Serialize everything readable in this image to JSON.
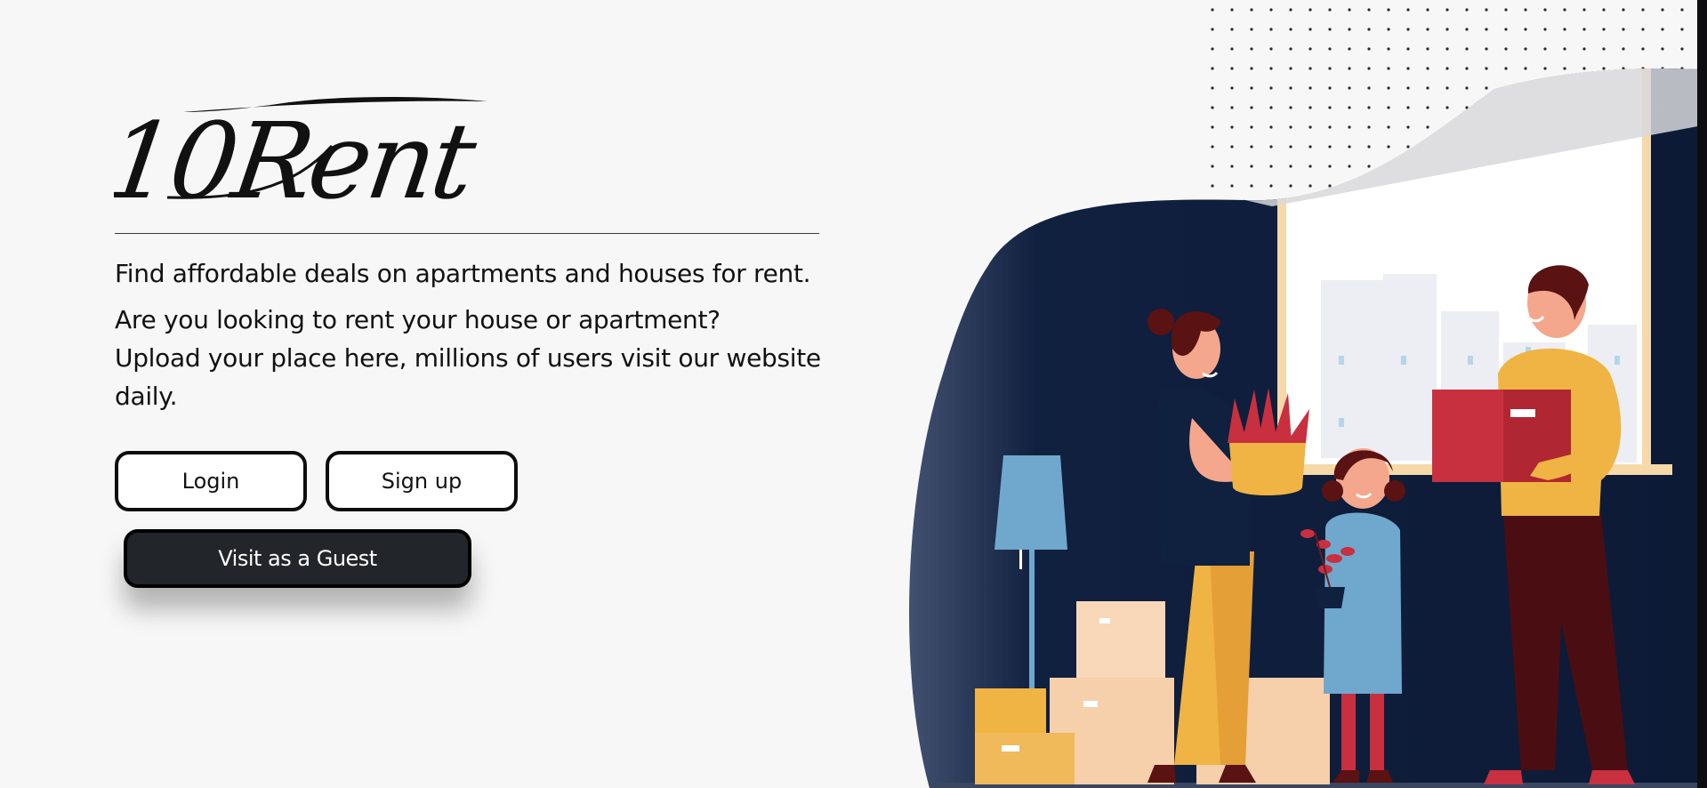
{
  "brand": {
    "logo_text": "10Rent"
  },
  "hero_text": {
    "tagline": "Find affordable deals on apartments and houses for rent.",
    "question": "Are you looking to rent your house or apartment?",
    "invite": "Upload your place here, millions of users visit our website daily."
  },
  "actions": {
    "login_label": "Login",
    "signup_label": "Sign up",
    "guest_label": "Visit as a Guest"
  },
  "colors": {
    "background": "#f7f7f7",
    "navy": "#10203f",
    "mustard": "#efb443",
    "crimson": "#c8303f",
    "sky_blue": "#6fa8cc",
    "guest_button": "#22262a"
  }
}
